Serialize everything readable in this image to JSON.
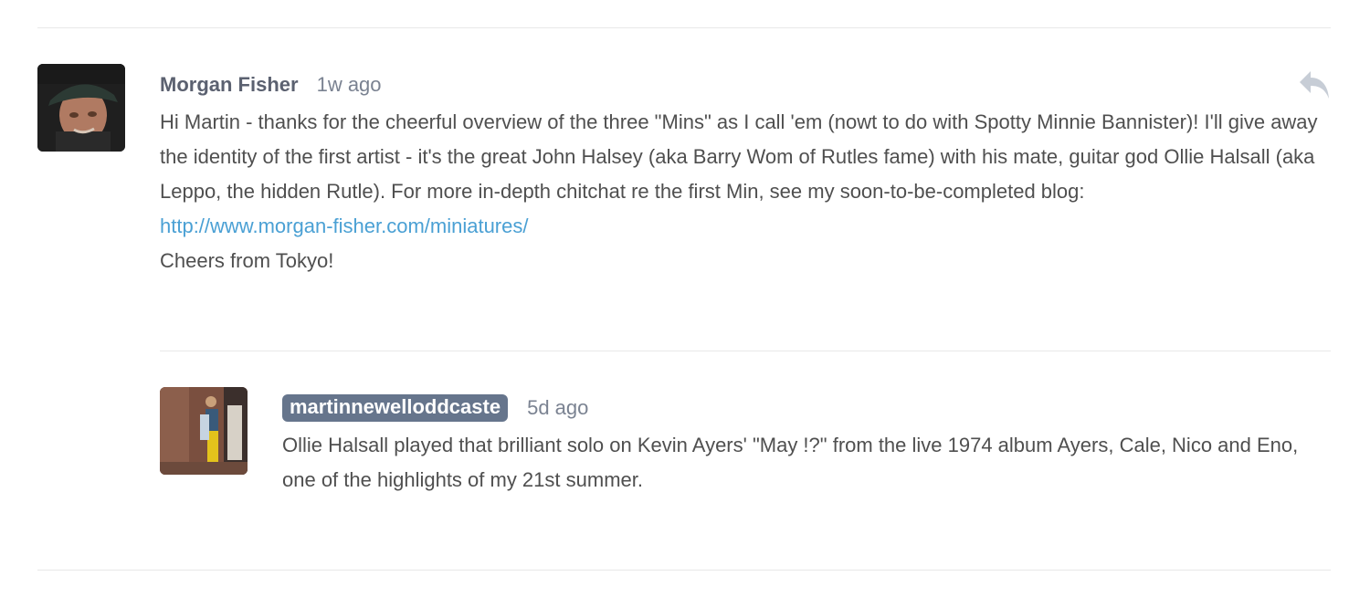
{
  "comment": {
    "author": "Morgan Fisher",
    "time": "1w ago",
    "avatar_icon": "user-photo",
    "paragraph": "Hi Martin - thanks for the cheerful overview of the three \"Mins\" as I call 'em (nowt to do with Spotty Minnie Bannister)! I'll give away the identity of the first artist - it's the great John Halsey (aka Barry Wom of Rutles fame) with his mate, guitar god Ollie Halsall (aka Leppo, the hidden Rutle). For more in-depth chitchat re the first Min, see my soon-to-be-completed blog:",
    "link": "http://www.morgan-fisher.com/miniatures/",
    "signoff": "Cheers from Tokyo!",
    "reply_icon": "reply-arrow-icon"
  },
  "reply": {
    "author": "martinnewelloddcaste",
    "time": "5d ago",
    "avatar_icon": "user-photo",
    "text": "Ollie Halsall played that brilliant solo on Kevin Ayers' \"May !?\" from the live 1974 album Ayers, Cale, Nico and Eno, one of the highlights of my 21st summer."
  },
  "colors": {
    "badge": "#66758c",
    "link": "#4aa0d4",
    "rule": "#e8e8e8"
  }
}
